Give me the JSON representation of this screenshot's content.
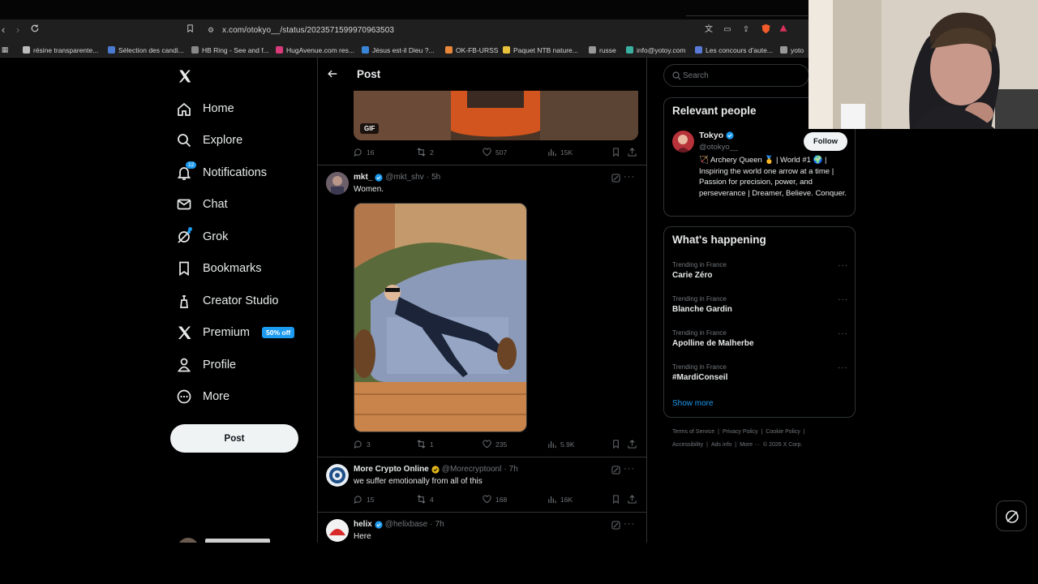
{
  "browser": {
    "url": "x.com/otokyo__/status/2023571599970963503",
    "bookmarks": [
      {
        "label": "résine transparente...",
        "color": "#bbbbbb"
      },
      {
        "label": "Sélection des candi...",
        "color": "#4a7bd0"
      },
      {
        "label": "HB Ring - See and f...",
        "color": "#888888"
      },
      {
        "label": "HugAvenue.com res...",
        "color": "#d83a7a"
      },
      {
        "label": "Jésus est-il Dieu ?...",
        "color": "#3a84d8"
      },
      {
        "label": "OK-FB-URSS",
        "color": "#e8873a"
      },
      {
        "label": "Paquet NTB nature...",
        "color": "#e8c23a"
      },
      {
        "label": "russe",
        "color": "#999999"
      },
      {
        "label": "info@yotoy.com",
        "color": "#3ab0a0"
      },
      {
        "label": "Les concours d'aute...",
        "color": "#5a7ad8"
      },
      {
        "label": "yoto",
        "color": "#999999"
      }
    ]
  },
  "nav": {
    "items": [
      {
        "label": "Home",
        "icon": "home-icon"
      },
      {
        "label": "Explore",
        "icon": "search-icon"
      },
      {
        "label": "Notifications",
        "icon": "bell-icon",
        "badge": "12"
      },
      {
        "label": "Chat",
        "icon": "mail-icon"
      },
      {
        "label": "Grok",
        "icon": "grok-icon"
      },
      {
        "label": "Bookmarks",
        "icon": "bookmark-icon"
      },
      {
        "label": "Creator Studio",
        "icon": "creator-studio-icon"
      },
      {
        "label": "Premium",
        "icon": "x-logo-icon",
        "badge": "50% off"
      },
      {
        "label": "Profile",
        "icon": "person-icon"
      },
      {
        "label": "More",
        "icon": "more-circle-icon"
      }
    ],
    "post_button": "Post"
  },
  "center": {
    "header_title": "Post",
    "gif_label": "GIF",
    "top_actions": {
      "replies": "16",
      "reposts": "2",
      "likes": "507",
      "views": "15K"
    },
    "tweets": [
      {
        "name": "mkt_",
        "handle": "@mkt_shv",
        "time": "5h",
        "text": "Women.",
        "replies": "3",
        "reposts": "1",
        "likes": "235",
        "views": "5.9K"
      },
      {
        "name": "More Crypto Online",
        "handle": "@Morecryptoonl",
        "time": "7h",
        "text": "we suffer emotionally from all of this",
        "replies": "15",
        "reposts": "4",
        "likes": "168",
        "views": "16K"
      },
      {
        "name": "helix",
        "handle": "@helixbase",
        "time": "7h",
        "text": "Here"
      }
    ]
  },
  "right": {
    "search_placeholder": "Search",
    "relevant": {
      "title": "Relevant people",
      "name": "Tokyo",
      "handle": "@otokyo__",
      "follow_label": "Follow",
      "bio": "🏹 Archery Queen 🥇 | World #1 🌍 | Inspiring the world one arrow at a time | Passion for precision, power, and perseverance | Dreamer, Believe. Conquer."
    },
    "happening": {
      "title": "What's happening",
      "trends": [
        {
          "context": "Trending in France",
          "name": "Carie Zéro"
        },
        {
          "context": "Trending in France",
          "name": "Blanche Gardin"
        },
        {
          "context": "Trending in France",
          "name": "Apolline de Malherbe"
        },
        {
          "context": "Trending in France",
          "name": "#MardiConseil"
        }
      ],
      "show_more": "Show more"
    },
    "footer": {
      "line1": [
        "Terms of Service",
        "|",
        "Privacy Policy",
        "|",
        "Cookie Policy",
        "|"
      ],
      "line2": [
        "Accessibility",
        "|",
        "Ads info",
        "|",
        "More ···",
        "© 2026 X Corp."
      ]
    }
  },
  "colors": {
    "accent": "#1d9bf0",
    "background": "#000000",
    "border": "#2f3336",
    "muted_text": "#71767b",
    "gold_badge": "#e2b719"
  }
}
